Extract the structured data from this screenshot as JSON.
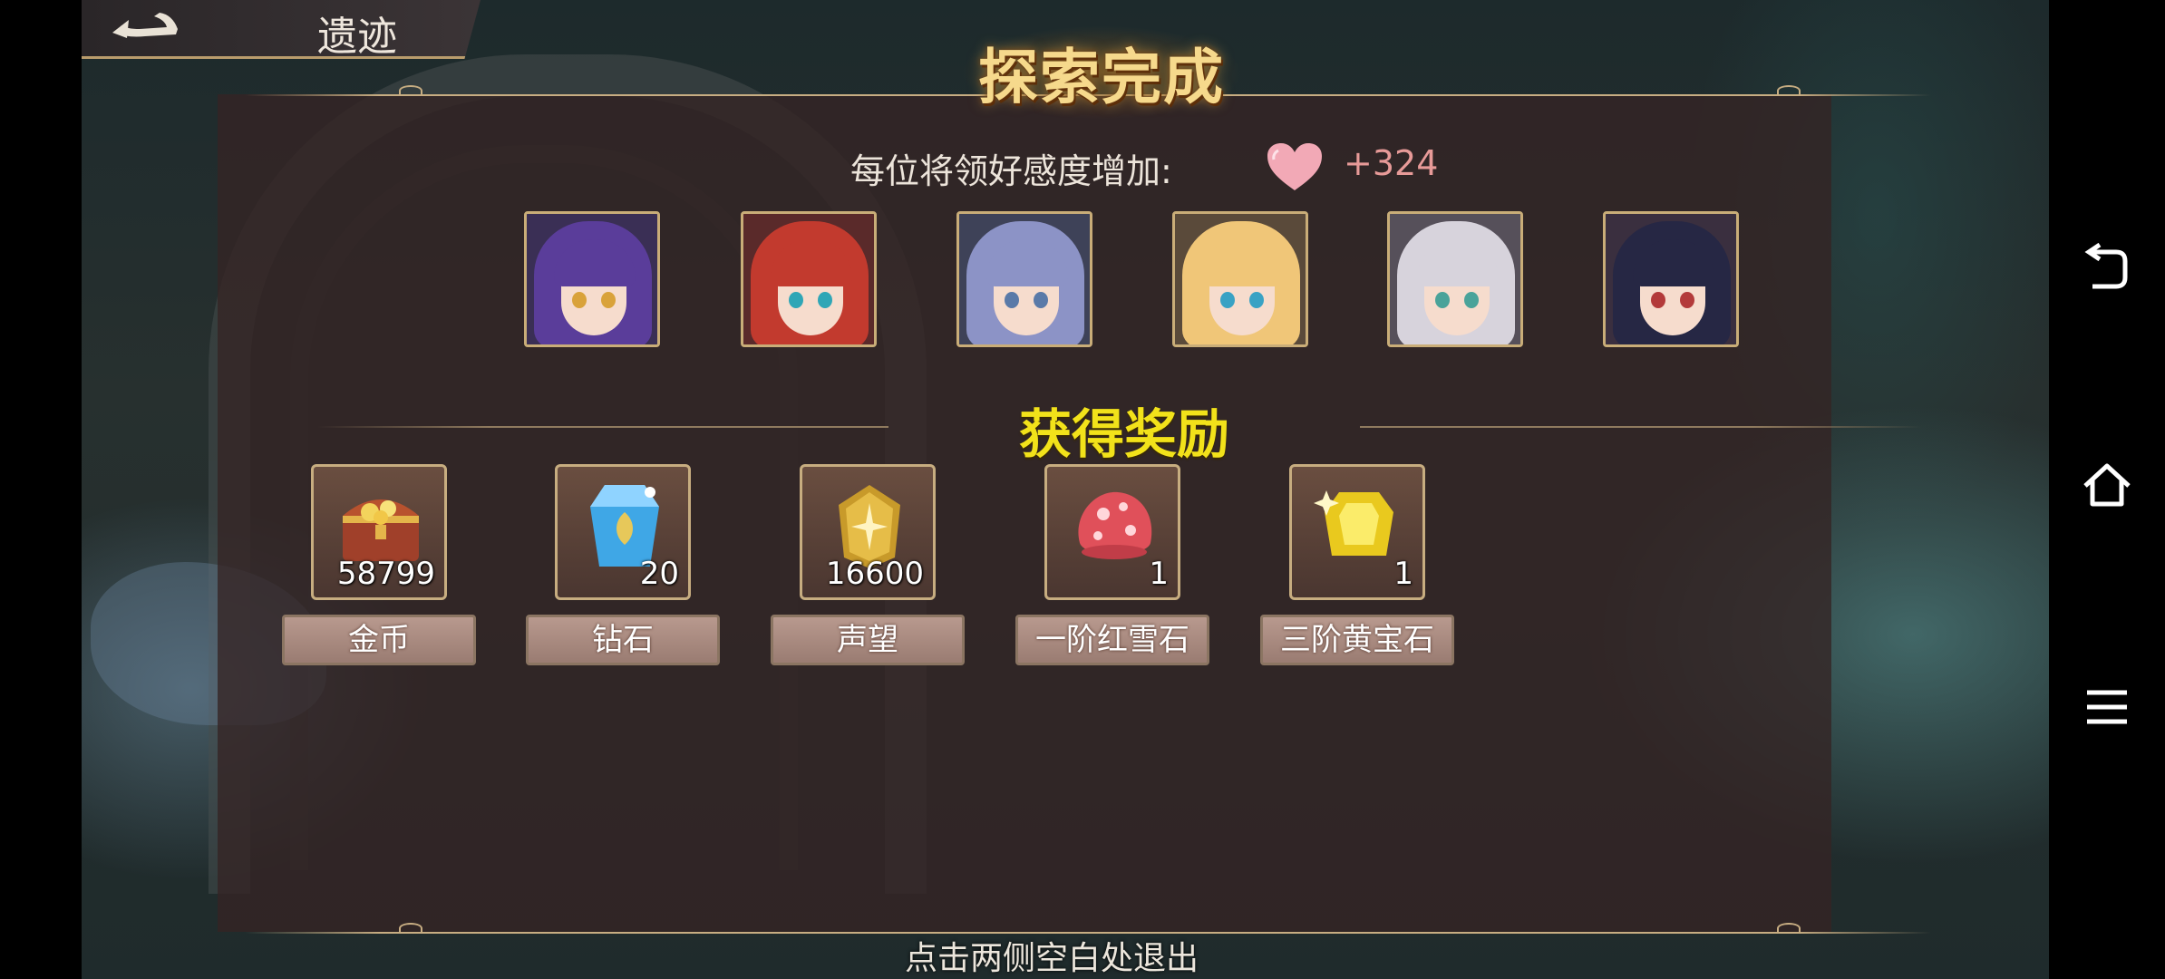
{
  "header": {
    "back_title": "遗迹"
  },
  "banner": {
    "title": "探索完成"
  },
  "affection": {
    "label": "每位将领好感度增加:",
    "value": "+324"
  },
  "heroes": [
    {
      "hair": "#5a3d9a",
      "eye": "#d9a23a",
      "bg": "#3a2f55"
    },
    {
      "hair": "#c23a2e",
      "eye": "#2fa6b6",
      "bg": "#5a2a2a"
    },
    {
      "hair": "#8c93c6",
      "eye": "#5a7aa8",
      "bg": "#3e4258"
    },
    {
      "hair": "#f0c678",
      "eye": "#39a2c4",
      "bg": "#5a4a3a"
    },
    {
      "hair": "#d7d3dc",
      "eye": "#4aa39a",
      "bg": "#56505a"
    },
    {
      "hair": "#262744",
      "eye": "#b33a3a",
      "bg": "#3a2f3f"
    }
  ],
  "rewards_title": "获得奖励",
  "rewards": [
    {
      "name": "金币",
      "count": "58799",
      "icon": "treasure-chest-icon"
    },
    {
      "name": "钻石",
      "count": "20",
      "icon": "diamond-crystal-icon"
    },
    {
      "name": "声望",
      "count": "16600",
      "icon": "prestige-badge-icon"
    },
    {
      "name": "一阶红雪石",
      "count": "1",
      "icon": "red-snow-stone-icon"
    },
    {
      "name": "三阶黄宝石",
      "count": "1",
      "icon": "yellow-gem-icon"
    }
  ],
  "footer": {
    "exit_hint": "点击两侧空白处退出"
  },
  "colors": {
    "title_gold": "#f6d98c",
    "section_yellow": "#f2e21a",
    "heart_pink": "#e79a98",
    "frame_gold": "#c7ad80"
  }
}
